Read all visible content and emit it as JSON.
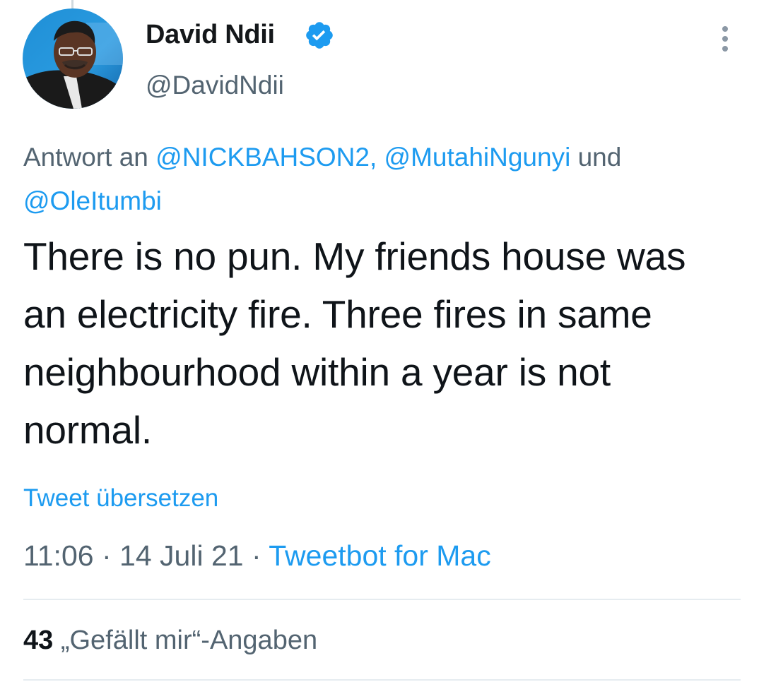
{
  "author": {
    "display_name": "David Ndii",
    "handle": "@DavidNdii",
    "verified_icon": "verified-badge-icon",
    "avatar_icon": "profile-photo"
  },
  "reply": {
    "prefix": "Antwort an",
    "mention_1": "@NICKBAHSON2,",
    "mention_2": "@MutahiNgunyi",
    "conjunction": "und",
    "mention_3": "@OleItumbi"
  },
  "tweet": {
    "text": "There is no pun. My friends house was an electricity fire. Three fires in same neighbourhood within a year is not normal.",
    "translate_label": "Tweet übersetzen"
  },
  "meta": {
    "time": "11:06",
    "separator": "·",
    "date": "14 Juli 21",
    "source": "Tweetbot for Mac"
  },
  "stats": {
    "likes_count": "43",
    "likes_label": "„Gefällt mir“-Angaben"
  },
  "more_icon": "more-vertical-icon",
  "colors": {
    "accent": "#1d9bf0",
    "secondary_text": "#536471",
    "primary_text": "#0f1419",
    "divider": "#e6ecf0"
  }
}
